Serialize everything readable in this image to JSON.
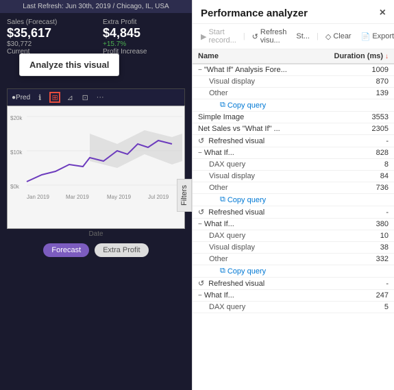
{
  "left": {
    "topbar": "Last Refresh: Jun 30th, 2019 / Chicago, IL, USA",
    "kpi1": {
      "label": "Sales (Forecast)",
      "value": "$35,617",
      "sub1": "$30,772",
      "sub2": "Current"
    },
    "kpi2": {
      "label": "Extra Profit",
      "value": "$4,845",
      "change": "+15.7%",
      "sub": "Profit Increase"
    },
    "analyze_tooltip": "Analyze this visual",
    "chart_label": "Date",
    "legend": [
      "Forecast",
      "Extra Profit"
    ],
    "filters_tab": "Filters"
  },
  "right": {
    "title": "Performance analyzer",
    "close": "×",
    "toolbar": {
      "record": "Start record...",
      "refresh": "Refresh visu...",
      "st": "St...",
      "clear": "Clear",
      "export": "Export"
    },
    "table": {
      "col_name": "Name",
      "col_duration": "Duration (ms)",
      "rows": [
        {
          "type": "group",
          "expand": "−",
          "name": "\"What If\" Analysis Fore...",
          "duration": "1009"
        },
        {
          "type": "sub",
          "name": "Visual display",
          "duration": "870"
        },
        {
          "type": "sub",
          "name": "Other",
          "duration": "139"
        },
        {
          "type": "copy",
          "name": "Copy query",
          "duration": ""
        },
        {
          "type": "item",
          "name": "Simple Image",
          "duration": "3553"
        },
        {
          "type": "item",
          "name": "Net Sales vs \"What If\" ...",
          "duration": "2305"
        },
        {
          "type": "refresh",
          "name": "Refreshed visual",
          "duration": "-"
        },
        {
          "type": "group",
          "expand": "−",
          "name": "What If...",
          "duration": "828"
        },
        {
          "type": "sub",
          "name": "DAX query",
          "duration": "8"
        },
        {
          "type": "sub",
          "name": "Visual display",
          "duration": "84"
        },
        {
          "type": "sub",
          "name": "Other",
          "duration": "736"
        },
        {
          "type": "copy",
          "name": "Copy query",
          "duration": ""
        },
        {
          "type": "refresh",
          "name": "Refreshed visual",
          "duration": "-"
        },
        {
          "type": "group",
          "expand": "−",
          "name": "What If...",
          "duration": "380"
        },
        {
          "type": "sub",
          "name": "DAX query",
          "duration": "10"
        },
        {
          "type": "sub",
          "name": "Visual display",
          "duration": "38"
        },
        {
          "type": "sub",
          "name": "Other",
          "duration": "332"
        },
        {
          "type": "copy",
          "name": "Copy query",
          "duration": ""
        },
        {
          "type": "refresh",
          "name": "Refreshed visual",
          "duration": "-"
        },
        {
          "type": "group",
          "expand": "−",
          "name": "What If...",
          "duration": "247"
        },
        {
          "type": "sub",
          "name": "DAX query",
          "duration": "5"
        }
      ]
    }
  }
}
